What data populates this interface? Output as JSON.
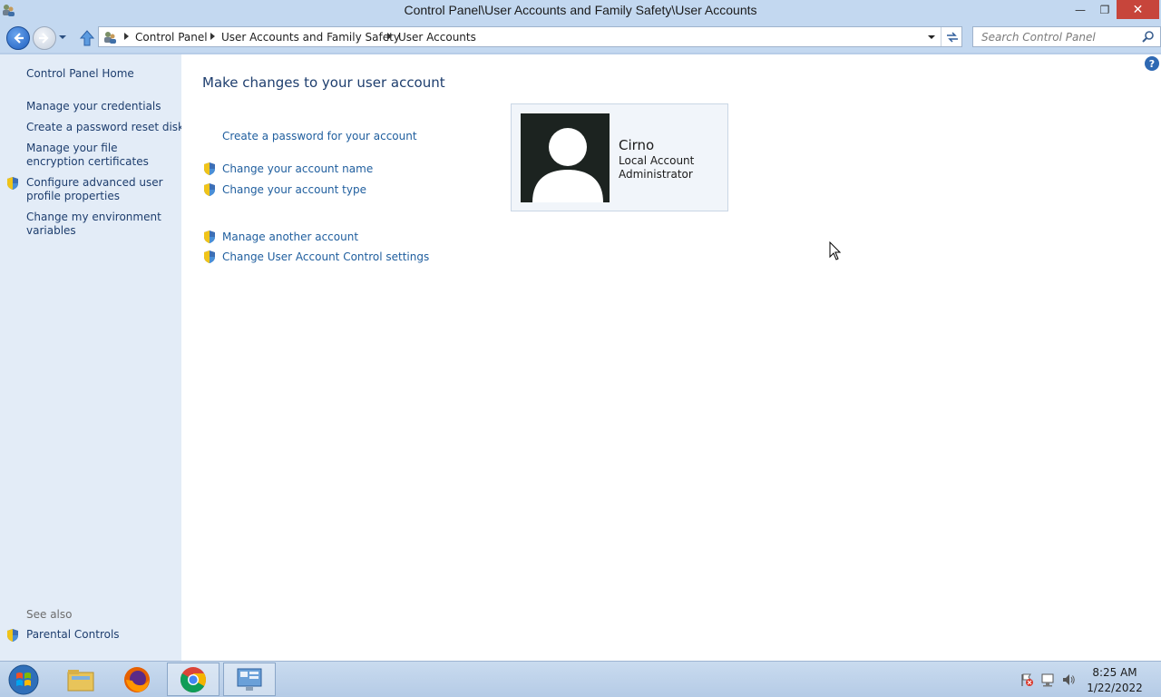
{
  "window": {
    "title": "Control Panel\\User Accounts and Family Safety\\User Accounts",
    "minimize": "—",
    "maximize": "❐",
    "close": "✕"
  },
  "address": {
    "breadcrumbs": [
      "Control Panel",
      "User Accounts and Family Safety",
      "User Accounts"
    ]
  },
  "search": {
    "placeholder": "Search Control Panel"
  },
  "sidebar": {
    "home": "Control Panel Home",
    "links": [
      "Manage your credentials",
      "Create a password reset disk",
      "Manage your file encryption certificates",
      "Configure advanced user profile properties",
      "Change my environment variables"
    ],
    "see_also_label": "See also",
    "see_also_links": [
      "Parental Controls"
    ]
  },
  "main": {
    "title": "Make changes to your user account",
    "tasks": [
      "Create a password for your account",
      "Change your account name",
      "Change your account type"
    ],
    "other_tasks": [
      "Manage another account",
      "Change User Account Control settings"
    ]
  },
  "user": {
    "name": "Cirno",
    "type": "Local Account",
    "role": "Administrator"
  },
  "clock": {
    "time": "8:25 AM",
    "date": "1/22/2022"
  },
  "taskbar": {
    "apps": [
      "file-explorer",
      "firefox",
      "chrome",
      "control-panel"
    ]
  }
}
